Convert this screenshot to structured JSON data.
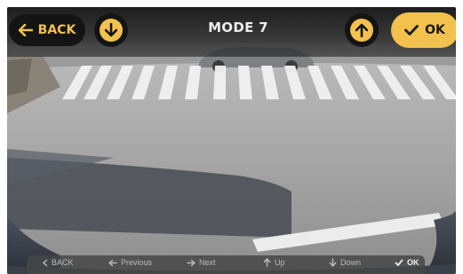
{
  "header": {
    "back_label": "BACK",
    "title": "MODE 7",
    "ok_label": "OK",
    "down_icon": "arrow-down-icon",
    "up_icon": "arrow-up-icon",
    "accent_color": "#f2c14e"
  },
  "camera": {
    "view": "rear-camera-feed"
  },
  "hints": {
    "back": "BACK",
    "previous": "Previous",
    "next": "Next",
    "up": "Up",
    "down": "Down",
    "ok": "OK"
  }
}
